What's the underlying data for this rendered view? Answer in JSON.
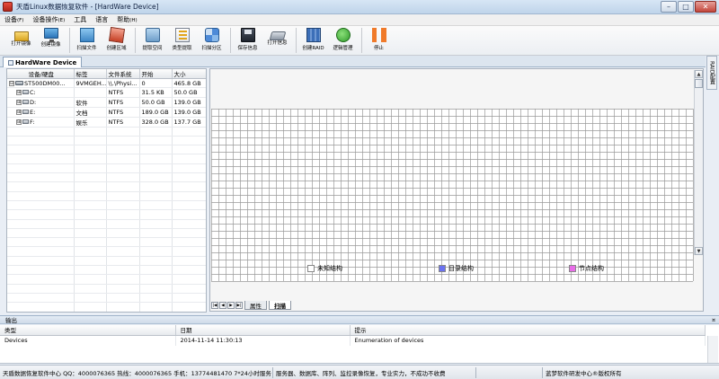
{
  "window": {
    "title": "天盾Linux数据恢复软件 - [HardWare Device]",
    "minimize": "–",
    "maximize": "□",
    "close": "✕"
  },
  "menu": [
    {
      "label": "设备",
      "acc": "(F)"
    },
    {
      "label": "设备操作",
      "acc": "(E)"
    },
    {
      "label": "工具",
      "acc": ""
    },
    {
      "label": "语言",
      "acc": ""
    },
    {
      "label": "帮助",
      "acc": "(H)"
    }
  ],
  "toolbar": {
    "open_image": "打开镜像",
    "create_image": "创建镜像",
    "scan_file": "扫描文件",
    "create_area": "创建区域",
    "extract_space": "提取空间",
    "type_extract": "类型提取",
    "scan_partition": "扫描分区",
    "save_info": "保存信息",
    "open_info": "打开信息",
    "create_raid": "创建RAID",
    "logic_manage": "逻辑管理",
    "stop": "停止"
  },
  "doc_tab": {
    "label": "HardWare Device"
  },
  "side_tab": {
    "label": "RAID配置"
  },
  "device_table": {
    "columns": [
      "设备/硬盘",
      "标签",
      "文件系统",
      "开始",
      "大小"
    ],
    "rows": [
      {
        "expander": "⊟",
        "device": "ST500DM00...",
        "label": "9VMGEH...",
        "fs": "\\\\.\\Physi...",
        "start": "0",
        "size": "465.8 GB"
      },
      {
        "expander": "⊞",
        "device": "C:",
        "label": "",
        "fs": "NTFS",
        "start": "31.5 KB",
        "size": "50.0 GB"
      },
      {
        "expander": "⊞",
        "device": "D:",
        "label": "软件",
        "fs": "NTFS",
        "start": "50.0 GB",
        "size": "139.0 GB"
      },
      {
        "expander": "⊞",
        "device": "E:",
        "label": "文档",
        "fs": "NTFS",
        "start": "189.0 GB",
        "size": "139.0 GB"
      },
      {
        "expander": "⊞",
        "device": "F:",
        "label": "娱乐",
        "fs": "NTFS",
        "start": "328.0 GB",
        "size": "137.7 GB"
      }
    ]
  },
  "map": {
    "scroll_up": "▲",
    "scroll_down": "▼",
    "legend": [
      {
        "label": "未知结构",
        "color": "#ffffff"
      },
      {
        "label": "目录结构",
        "color": "#6b72f0"
      },
      {
        "label": "节点结构",
        "color": "#e86de8"
      }
    ],
    "nav_buttons": [
      "|◀",
      "◀",
      "▶",
      "▶|"
    ],
    "tabs": [
      {
        "label": "属性",
        "active": false
      },
      {
        "label": "扫描",
        "active": true
      }
    ]
  },
  "output": {
    "title": "输出",
    "pin": "¤",
    "columns": [
      "类型",
      "日期",
      "提示"
    ],
    "rows": [
      {
        "type": "Devices",
        "date": "2014-11-14 11:30:13",
        "hint": "Enumeration of devices"
      }
    ]
  },
  "status": {
    "seg1": "天盾数据恢复软件中心 QQ：4000076365 热线：4000076365 手机：13774481470   7*24小时服务",
    "seg2": "服务器、数据库、阵列、监控录像恢复，专业实力，不成功不收费",
    "seg3": "",
    "seg4": "蓝梦软件研发中心®版权所有"
  }
}
